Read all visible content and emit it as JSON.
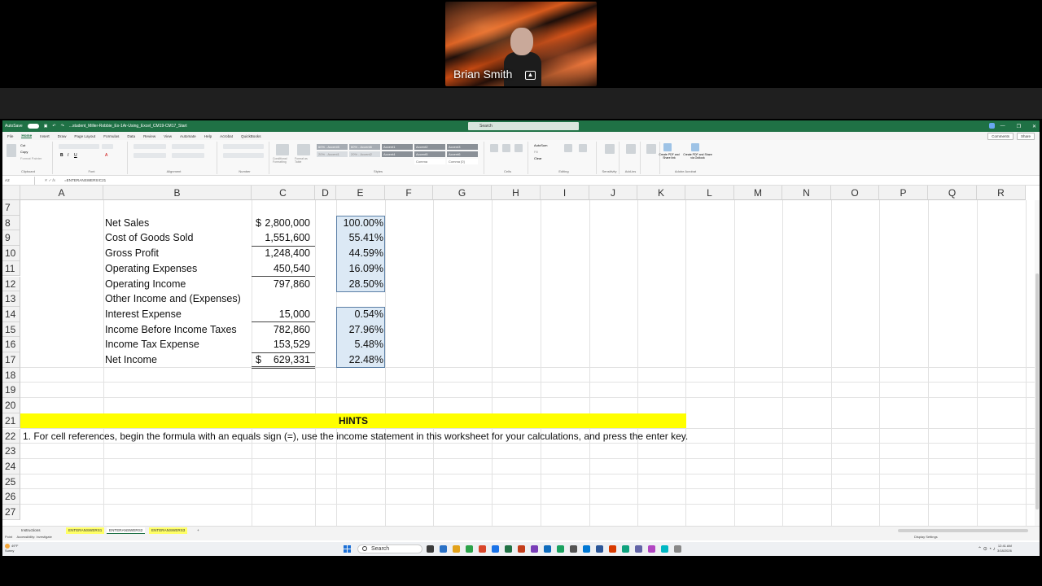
{
  "meeting": {
    "participant_name": "Brian Smith"
  },
  "excel": {
    "title_items": [
      "AutoSave",
      "Off",
      "...student_Miller-Robbie_Ex-1Ar-Using_Excel_CM19-CM17_Start"
    ],
    "search_placeholder": "Search",
    "ribbon_tabs": [
      "File",
      "Home",
      "Insert",
      "Draw",
      "Page Layout",
      "Formulas",
      "Data",
      "Review",
      "View",
      "Automate",
      "Help",
      "Acrobat",
      "QuickBooks"
    ],
    "active_tab": "Home",
    "comments_label": "Comments",
    "share_label": "Share",
    "ribbon_groups": [
      "Clipboard",
      "Font",
      "Alignment",
      "Number",
      "Styles",
      "Cells",
      "Editing",
      "Sensitivity",
      "Add-ins",
      "Adobe Acrobat"
    ],
    "ribbon_buttons": [
      "Cut",
      "Copy",
      "Format Painter",
      "Conditional Formatting",
      "Format as Table",
      "Insert",
      "Delete",
      "Format",
      "AutoSum",
      "Fill",
      "Clear",
      "Sort & Filter",
      "Find & Select",
      "Sensitivity",
      "Add-ins",
      "Create PDF and Share link",
      "Create PDF and Share via Outlook"
    ],
    "style_cells": [
      "60% - Accent5",
      "60% - Accent6",
      "Accent1",
      "Accent2",
      "Accent3",
      "20% - Accent1",
      "20% - Accent2",
      "Accent4",
      "Accent5",
      "Accent6",
      "Comma",
      "Comma [0]"
    ],
    "name_box": "A2",
    "formula": "=ENTERANSWERS!C21",
    "columns": [
      "A",
      "B",
      "C",
      "D",
      "E",
      "F",
      "G",
      "H",
      "I",
      "J",
      "K",
      "L",
      "M",
      "N",
      "O",
      "P",
      "Q",
      "R"
    ],
    "rows": [
      "7",
      "8",
      "9",
      "10",
      "11",
      "12",
      "13",
      "14",
      "15",
      "16",
      "17",
      "18",
      "19",
      "20",
      "21",
      "22",
      "23",
      "24",
      "25",
      "26",
      "27"
    ],
    "income_statement": [
      {
        "label": "Net Sales",
        "amount": "2,800,000",
        "currency": "$",
        "percent": "100.00%"
      },
      {
        "label": "Cost of Goods Sold",
        "amount": "1,551,600",
        "currency": "",
        "percent": "55.41%"
      },
      {
        "label": "Gross Profit",
        "amount": "1,248,400",
        "currency": "",
        "percent": "44.59%"
      },
      {
        "label": "Operating Expenses",
        "amount": "450,540",
        "currency": "",
        "percent": "16.09%"
      },
      {
        "label": "Operating Income",
        "amount": "797,860",
        "currency": "",
        "percent": "28.50%"
      },
      {
        "label": "Other Income and (Expenses)",
        "amount": "",
        "currency": "",
        "percent": ""
      },
      {
        "label": "Interest Expense",
        "amount": "15,000",
        "currency": "",
        "percent": "0.54%"
      },
      {
        "label": "Income Before Income Taxes",
        "amount": "782,860",
        "currency": "",
        "percent": "27.96%"
      },
      {
        "label": "Income Tax Expense",
        "amount": "153,529",
        "currency": "",
        "percent": "5.48%"
      },
      {
        "label": "Net Income",
        "amount": "629,331",
        "currency": "$",
        "percent": "22.48%"
      }
    ],
    "hints_title": "HINTS",
    "hint_1": "1. For cell references, begin the formula with an equals sign (=), use the income statement in this worksheet for your calculations, and press the enter key.",
    "sheet_tabs": [
      "Instructions",
      "ENTERANSWERS1",
      "ENTERANSWERS2",
      "ENTERANSWERS3"
    ],
    "active_sheet": "ENTERANSWERS2",
    "status_left": "Point",
    "status_accessibility": "Accessibility: Investigate",
    "status_right": "Display Settings"
  },
  "taskbar": {
    "weather_temp": "49°F",
    "weather_desc": "Sunny",
    "search_label": "Search",
    "time": "12:41 AM",
    "date": "3/18/2026",
    "icon_colors": [
      "#3b3b3b",
      "#2a71c6",
      "#e2a21b",
      "#2ba34a",
      "#d9472b",
      "#1a73e8",
      "#217346",
      "#c43e1c",
      "#7a3fb8",
      "#0f6cbd",
      "#1aa260",
      "#555555",
      "#0078d4",
      "#2b579a",
      "#d83b01",
      "#10a37f",
      "#6264a7",
      "#b146c2",
      "#00b7c3",
      "#888888"
    ]
  },
  "colors": {
    "excel_green": "#1f7145",
    "hints_yellow": "#ffff00",
    "pct_fill": "#dce9f5",
    "pct_border": "#5b7fa6"
  }
}
